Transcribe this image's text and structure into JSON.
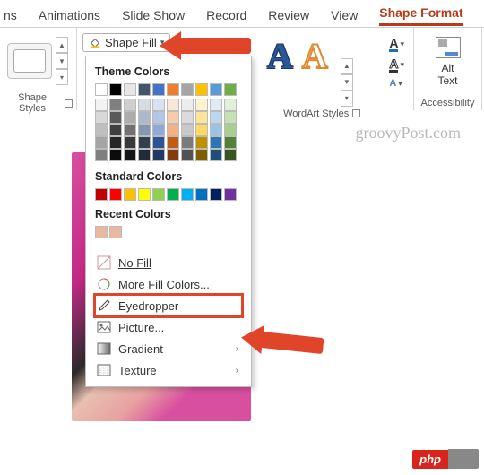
{
  "tabs": {
    "t0": "ns",
    "t1": "Animations",
    "t2": "Slide Show",
    "t3": "Record",
    "t4": "Review",
    "t5": "View",
    "t6": "Shape Format"
  },
  "ribbon": {
    "shape_fill_label": "Shape Fill",
    "shape_styles_label": "Shape Styles",
    "wordart_label": "WordArt Styles",
    "accessibility_label": "Accessibility",
    "alt_text_label": "Alt\nText",
    "wa_letter": "A"
  },
  "flyout": {
    "theme_heading": "Theme Colors",
    "standard_heading": "Standard Colors",
    "recent_heading": "Recent Colors",
    "theme_top": [
      "#ffffff",
      "#000000",
      "#e7e6e6",
      "#44546a",
      "#4472c4",
      "#ed7d31",
      "#a5a5a5",
      "#ffc000",
      "#5b9bd5",
      "#70ad47"
    ],
    "theme_shades": [
      [
        "#f2f2f2",
        "#7f7f7f",
        "#d0cece",
        "#d6dce4",
        "#d9e2f3",
        "#fbe5d5",
        "#ededed",
        "#fff2cc",
        "#deebf6",
        "#e2efd9"
      ],
      [
        "#d8d8d8",
        "#595959",
        "#aeabab",
        "#adb9ca",
        "#b4c6e7",
        "#f7cbac",
        "#dbdbdb",
        "#fee599",
        "#bdd7ee",
        "#c5e0b3"
      ],
      [
        "#bfbfbf",
        "#3f3f3f",
        "#757070",
        "#8496b0",
        "#8eaadb",
        "#f4b183",
        "#c9c9c9",
        "#ffd965",
        "#9cc3e5",
        "#a8d08d"
      ],
      [
        "#a5a5a5",
        "#262626",
        "#3a3838",
        "#323f4f",
        "#2f5496",
        "#c55a11",
        "#7b7b7b",
        "#bf9000",
        "#2e75b5",
        "#538135"
      ],
      [
        "#7f7f7f",
        "#0c0c0c",
        "#171616",
        "#222a35",
        "#1f3864",
        "#833c0b",
        "#525252",
        "#7f6000",
        "#1e4e79",
        "#375623"
      ]
    ],
    "standard": [
      "#c00000",
      "#ff0000",
      "#ffc000",
      "#ffff00",
      "#92d050",
      "#00b050",
      "#00b0f0",
      "#0070c0",
      "#002060",
      "#7030a0"
    ],
    "recent": [
      "#e8b8a0",
      "#e8b8a0"
    ],
    "no_fill": "No Fill",
    "more_colors": "More Fill Colors...",
    "eyedropper": "Eyedropper",
    "picture": "Picture...",
    "gradient": "Gradient",
    "texture": "Texture"
  },
  "watermark": "groovyPost.com",
  "badge": "php"
}
